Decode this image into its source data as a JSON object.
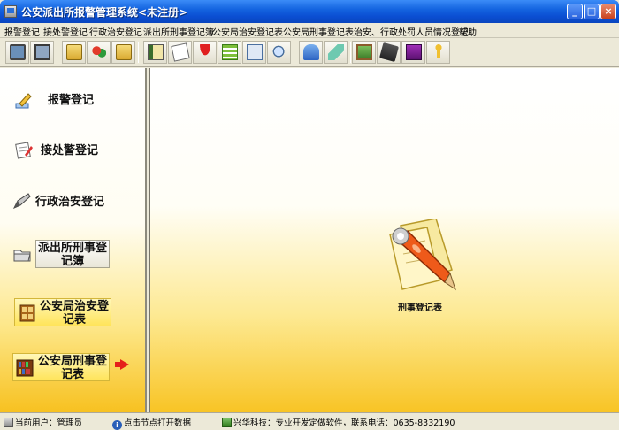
{
  "window": {
    "title": "公安派出所报警管理系统<未注册>",
    "controls": {
      "minimize": "_",
      "maximize": "□",
      "close": "×"
    }
  },
  "menu": [
    "报警登记",
    "接处警登记",
    "行政治安登记",
    "派出所刑事登记簿",
    "公安局治安登记表",
    "公安局刑事登记表",
    "治安、行政处罚人员情况登记",
    "帮助"
  ],
  "toolbar": {
    "buttons": [
      "monitor-icon",
      "monitor-icon",
      "folder-icon",
      "people-icon",
      "folder-icon",
      "book-icon",
      "note-icon",
      "umbrella-icon",
      "list-icon",
      "search-doc-icon",
      "magnifier-icon",
      "bell-icon",
      "ribbon-icon",
      "picture-icon",
      "pda-icon",
      "purple-book-icon",
      "runner-icon"
    ]
  },
  "sidebar": {
    "items": [
      {
        "label": "报警登记",
        "icon": "pencil-icon"
      },
      {
        "label": "接处警登记",
        "icon": "note-icon"
      },
      {
        "label": "行政治安登记",
        "icon": "pen-icon"
      },
      {
        "label": "派出所刑事登记簿",
        "line1": "派出所刑事登",
        "line2": "记簿",
        "icon": "folder-icon"
      },
      {
        "label": "公安局治安登记表",
        "line1": "公安局治安登",
        "line2": "记表",
        "icon": "cabinet-icon"
      },
      {
        "label": "公安局刑事登记表",
        "line1": "公安局刑事登",
        "line2": "记表",
        "icon": "bookshelf-icon",
        "active": true
      }
    ]
  },
  "main": {
    "feature_label": "刑事登记表",
    "feature_icon": "documents-pen-icon"
  },
  "status": {
    "user": "当前用户：管理员",
    "hint": "点击节点打开数据",
    "company": "兴华科技：专业开发定做软件，联系电话：0635-8332190"
  },
  "colors": {
    "titlebar": "#0b4fd3",
    "gradient_yellow": "#f8c425",
    "active_arrow": "#e5201a"
  }
}
